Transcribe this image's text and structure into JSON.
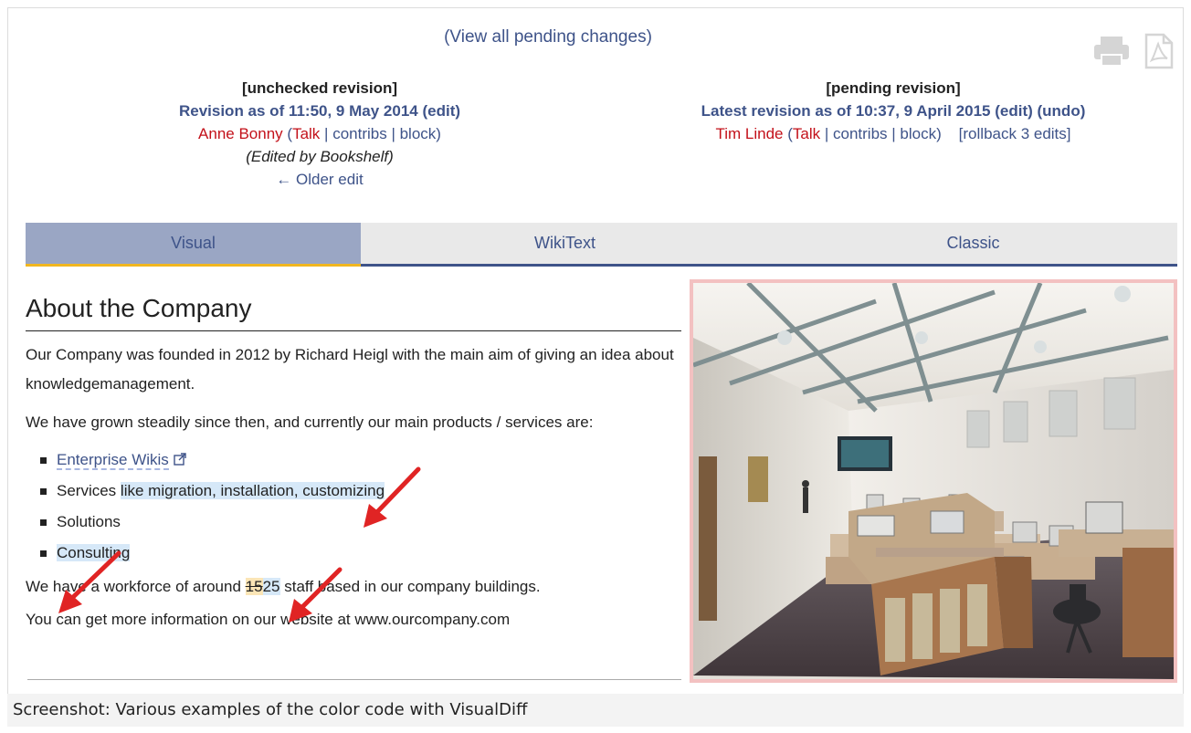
{
  "header": {
    "pending_link": "(View all pending changes)"
  },
  "left_revision": {
    "status": "[unchecked revision]",
    "title": "Revision as of 11:50, 9 May 2014",
    "edit": "(edit)",
    "user": "Anne Bonny",
    "talk": "Talk",
    "contribs": "contribs",
    "block": "block",
    "edited_by": "(Edited by Bookshelf)",
    "older_edit": "← Older edit"
  },
  "right_revision": {
    "status": "[pending revision]",
    "title": "Latest revision as of 10:37, 9 April 2015",
    "edit": "(edit)",
    "undo": "(undo)",
    "user": "Tim Linde",
    "talk": "Talk",
    "contribs": "contribs",
    "block": "block",
    "rollback": "[rollback 3 edits]"
  },
  "tabs": [
    {
      "label": "Visual",
      "active": true
    },
    {
      "label": "WikiText",
      "active": false
    },
    {
      "label": "Classic",
      "active": false
    }
  ],
  "article": {
    "heading": "About the Company",
    "para1": "Our Company was founded in 2012 by Richard Heigl with the main aim of giving an idea about knowledgemanagement.",
    "para2": "We have grown steadily since then, and currently our main products / services are:",
    "list": {
      "item1": "Enterprise Wikis",
      "item2_plain": "Services ",
      "item2_added": "like migration, installation, customizing",
      "item3": "Solutions",
      "item4": "Consulting"
    },
    "para3_before": "We have a workforce of around ",
    "para3_deleted": "15",
    "para3_added": "25",
    "para3_after": " staff based in our company buildings.",
    "para4": "You can get more information on our website at www.ourcompany.com"
  },
  "caption": "Screenshot: Various examples of the color code with VisualDiff",
  "colors": {
    "link": "#3e5389",
    "user": "#c3111a",
    "added_highlight": "#d6e8f8",
    "deleted_highlight": "#fbe5b6",
    "active_tab": "#9aa6c4",
    "tab_accent": "#f1b620",
    "arrow": "#e02424"
  },
  "icons": [
    "print-icon",
    "pdf-icon",
    "external-link-icon"
  ]
}
